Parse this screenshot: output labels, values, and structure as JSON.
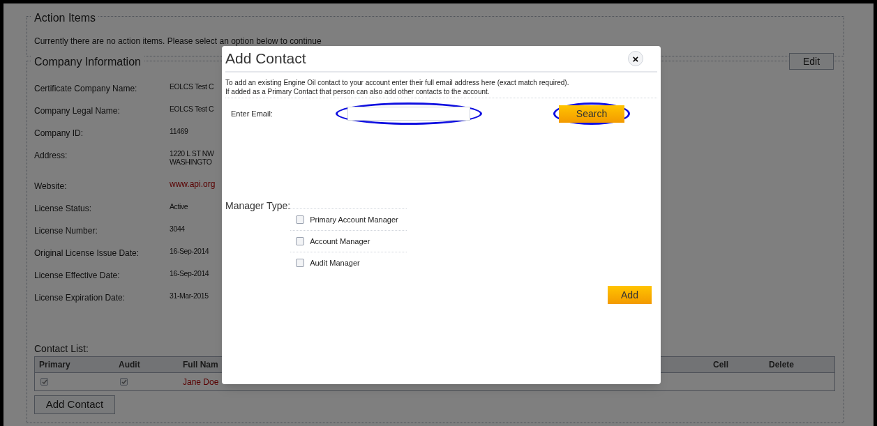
{
  "action_items": {
    "title": "Action Items",
    "message": "Currently there are no action items. Please select an option below to continue"
  },
  "company_information": {
    "title": "Company Information",
    "edit_button": "Edit",
    "fields": [
      {
        "label": "Certificate Company Name:",
        "value": [
          "EOLCS Test C"
        ],
        "kind": "text"
      },
      {
        "label": "Company Legal Name:",
        "value": [
          "EOLCS Test C"
        ],
        "kind": "text"
      },
      {
        "label": "Company ID:",
        "value": [
          "11469"
        ],
        "kind": "text"
      },
      {
        "label": "Address:",
        "value": [
          "1220 L ST NW",
          "WASHINGTO"
        ],
        "kind": "text"
      },
      {
        "label": "Website:",
        "value": [
          "www.api.org"
        ],
        "kind": "link"
      },
      {
        "label": "License Status:",
        "value": [
          "Active"
        ],
        "kind": "text"
      },
      {
        "label": "License Number:",
        "value": [
          "3044"
        ],
        "kind": "text"
      },
      {
        "label": "Original License Issue Date:",
        "value": [
          "16-Sep-2014"
        ],
        "kind": "text"
      },
      {
        "label": "License Effective Date:",
        "value": [
          "16-Sep-2014"
        ],
        "kind": "text"
      },
      {
        "label": "License Expiration Date:",
        "value": [
          "31-Mar-2015"
        ],
        "kind": "text"
      }
    ]
  },
  "contact_list": {
    "title": "Contact List:",
    "columns": [
      "Primary",
      "Audit",
      "Full Nam",
      "Cell",
      "Delete"
    ],
    "rows": [
      {
        "primary": true,
        "audit": true,
        "full_name": "Jane Doe"
      }
    ],
    "add_button": "Add Contact"
  },
  "dialog": {
    "title": "Add Contact",
    "close": "×",
    "description": [
      "To add an existing Engine Oil contact to your account enter their full email address here (exact match required).",
      "If added as a Primary Contact that person can also add other contacts to the account."
    ],
    "email_label": "Enter Email:",
    "email_field": {
      "highlighted": true
    },
    "search_button": {
      "label": "Search",
      "highlighted": true
    },
    "manager_type_label": "Manager Type:",
    "manager_types": [
      {
        "label": "Primary Account Manager",
        "checked": false
      },
      {
        "label": "Account Manager",
        "checked": false
      },
      {
        "label": "Audit Manager",
        "checked": false
      }
    ],
    "add_button": "Add"
  }
}
